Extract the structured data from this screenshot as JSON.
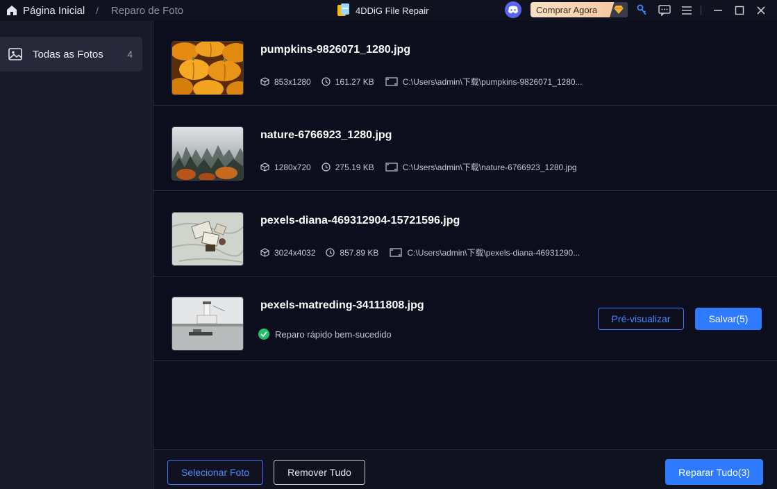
{
  "titlebar": {
    "breadcrumb_home": "Página Inicial",
    "breadcrumb_sep": "/",
    "breadcrumb_current": "Reparo de Foto",
    "app_name": "4DDiG File Repair",
    "buy_label": "Comprar Agora"
  },
  "sidebar": {
    "items": [
      {
        "label": "Todas as Fotos",
        "count": "4"
      }
    ]
  },
  "files": [
    {
      "name": "pumpkins-9826071_1280.jpg",
      "dimensions": "853x1280",
      "size": "161.27 KB",
      "path": "C:\\Users\\admin\\下载\\pumpkins-9826071_1280..."
    },
    {
      "name": "nature-6766923_1280.jpg",
      "dimensions": "1280x720",
      "size": "275.19 KB",
      "path": "C:\\Users\\admin\\下载\\nature-6766923_1280.jpg"
    },
    {
      "name": "pexels-diana-469312904-15721596.jpg",
      "dimensions": "3024x4032",
      "size": "857.89 KB",
      "path": "C:\\Users\\admin\\下载\\pexels-diana-46931290..."
    },
    {
      "name": "pexels-matreding-34111808.jpg",
      "status": "Reparo rápido bem-sucedido",
      "preview_label": "Pré-visualizar",
      "save_label": "Salvar(5)"
    }
  ],
  "footer": {
    "select_label": "Selecionar Foto",
    "remove_label": "Remover Tudo",
    "repair_label": "Reparar Tudo(3)"
  },
  "colors": {
    "accent": "#2f7bff",
    "success": "#21c06b",
    "background": "#0c0d1d",
    "sidebar": "#181929"
  }
}
